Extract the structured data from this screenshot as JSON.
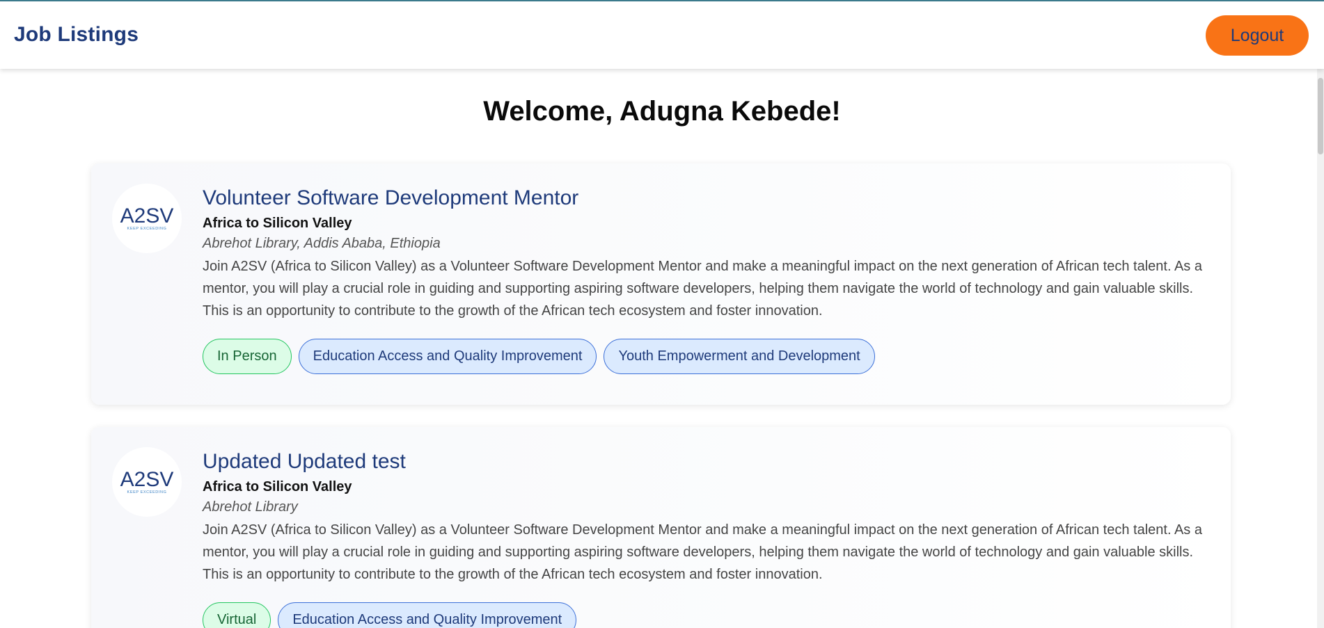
{
  "header": {
    "title": "Job Listings",
    "logout_label": "Logout"
  },
  "welcome": "Welcome, Adugna Kebede!",
  "colors": {
    "brand": "#1e3a7a",
    "logout_bg": "#f97316",
    "tag_green_bg": "#dcfce7",
    "tag_green_border": "#22c55e",
    "tag_blue_bg": "#dbeafe",
    "tag_blue_border": "#3b6fd8"
  },
  "logo": {
    "icon": "a2sv-logo-icon",
    "text": "A2SV",
    "tagline": "KEEP EXCEEDING"
  },
  "jobs": [
    {
      "title": "Volunteer Software Development Mentor",
      "company": "Africa to Silicon Valley",
      "location": "Abrehot Library, Addis Ababa, Ethiopia",
      "description": "Join A2SV (Africa to Silicon Valley) as a Volunteer Software Development Mentor and make a meaningful impact on the next generation of African tech talent. As a mentor, you will play a crucial role in guiding and supporting aspiring software developers, helping them navigate the world of technology and gain valuable skills. This is an opportunity to contribute to the growth of the African tech ecosystem and foster innovation.",
      "tags": [
        {
          "label": "In Person",
          "kind": "green"
        },
        {
          "label": "Education Access and Quality Improvement",
          "kind": "blue"
        },
        {
          "label": "Youth Empowerment and Development",
          "kind": "blue"
        }
      ]
    },
    {
      "title": "Updated Updated test",
      "company": "Africa to Silicon Valley",
      "location": "Abrehot Library",
      "description": "Join A2SV (Africa to Silicon Valley) as a Volunteer Software Development Mentor and make a meaningful impact on the next generation of African tech talent. As a mentor, you will play a crucial role in guiding and supporting aspiring software developers, helping them navigate the world of technology and gain valuable skills. This is an opportunity to contribute to the growth of the African tech ecosystem and foster innovation.",
      "tags": [
        {
          "label": "Virtual",
          "kind": "green"
        },
        {
          "label": "Education Access and Quality Improvement",
          "kind": "blue"
        }
      ]
    }
  ]
}
